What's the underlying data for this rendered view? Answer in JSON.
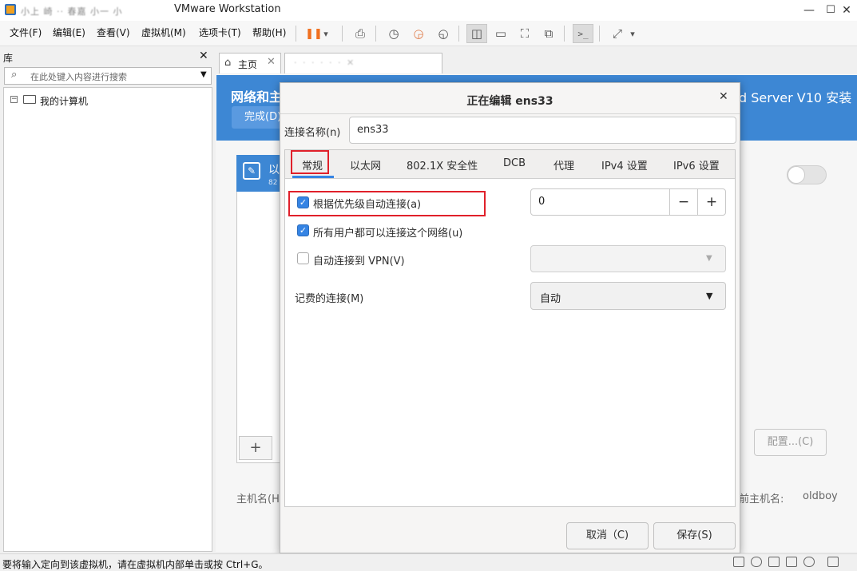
{
  "window": {
    "title": "VMware Workstation",
    "title_prefix_blurred": "小上 崎 ·· 春嘉 小一 小",
    "controls": {
      "minimize": "—",
      "maximize": "☐",
      "close": "✕"
    }
  },
  "menu": {
    "file": "文件(F)",
    "edit": "编辑(E)",
    "view": "查看(V)",
    "vm": "虚拟机(M)",
    "tabs": "选项卡(T)",
    "help": "帮助(H)"
  },
  "toolbar": {
    "pause_icon": "❚❚",
    "dropdown_icon": "▾",
    "send_keys_icon": "⎙",
    "snapshot_icon": "◷",
    "revert_icon": "◶",
    "manage_snapshots_icon": "◵",
    "show_library_icon": "◫",
    "thumbnail_icon": "▭",
    "fullscreen_icon": "⛶",
    "unity_icon": "⧉",
    "console_icon": ">_",
    "stretch_icon": "⤢"
  },
  "library": {
    "title": "库",
    "close": "✕",
    "search_placeholder": "在此处键入内容进行搜索",
    "tree_toggle": "−",
    "tree_root": "我的计算机"
  },
  "tabs": {
    "home_label": "主页",
    "home_close": "✕",
    "vm_label_blurred": "· ‧ · · · · ✕"
  },
  "installer": {
    "header_left": "网络和主",
    "done_button": "完成(D)",
    "header_right": "d Server V10 安装",
    "net_item_label": "以",
    "net_item_sub": "82",
    "add_button": "+",
    "configure_button": "配置...(C)",
    "hostname_left": "主机名(H",
    "hostname_right_label": "前主机名:",
    "hostname_value": "oldboy"
  },
  "dialog": {
    "title": "正在编辑 ens33",
    "close": "✕",
    "connection_name_label": "连接名称(n)",
    "connection_name_value": "ens33",
    "tabs": [
      "常规",
      "以太网",
      "802.1X 安全性",
      "DCB",
      "代理",
      "IPv4 设置",
      "IPv6 设置"
    ],
    "auto_connect_priority_label": "根据优先级自动连接(a)",
    "auto_connect_priority_checked": true,
    "priority_value": "0",
    "priority_minus": "−",
    "priority_plus": "+",
    "all_users_label": "所有用户都可以连接这个网络(u)",
    "all_users_checked": true,
    "auto_vpn_label": "自动连接到 VPN(V)",
    "auto_vpn_checked": false,
    "vpn_value": "",
    "metered_label": "记费的连接(M)",
    "metered_value": "自动",
    "cancel_button": "取消（C)",
    "save_button": "保存(S)",
    "check_mark": "✓",
    "combo_arrow": "▼"
  },
  "status": {
    "text": "要将输入定向到该虚拟机，请在虚拟机内部单击或按 Ctrl+G。"
  },
  "colors": {
    "installer_blue": "#3d87d4",
    "highlight_red": "#e0202a",
    "check_blue": "#3584e4",
    "pause_orange": "#f07020"
  }
}
